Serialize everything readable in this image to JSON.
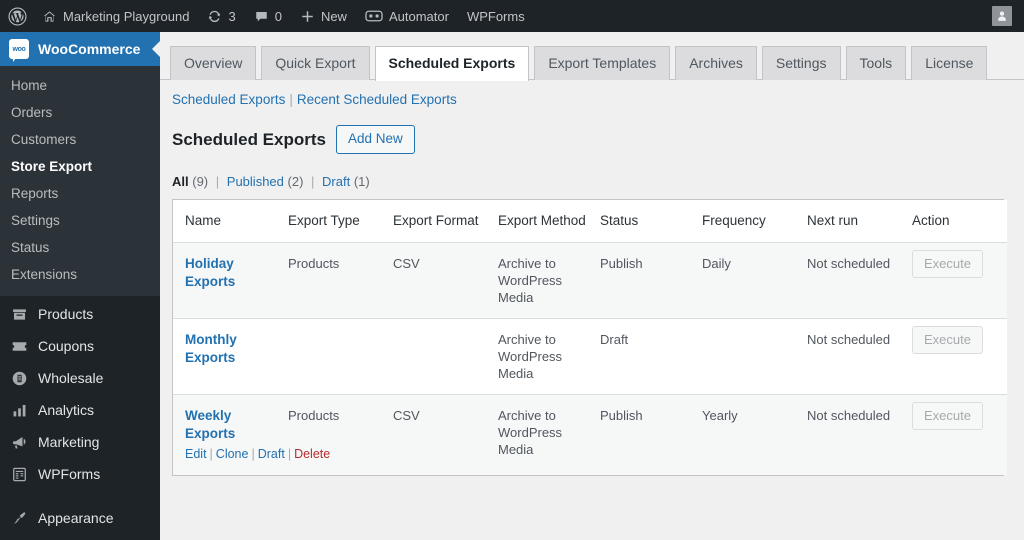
{
  "adminbar": {
    "items": [
      {
        "icon": "wordpress-logo-icon",
        "label": ""
      },
      {
        "icon": "home-icon",
        "label": "Marketing Playground"
      },
      {
        "icon": "updates-icon",
        "label": "3"
      },
      {
        "icon": "comment-bubble-icon",
        "label": "0"
      },
      {
        "icon": "plus-icon",
        "label": "New"
      },
      {
        "icon": "automator-robot-icon",
        "label": "Automator"
      },
      {
        "icon": "",
        "label": "WPForms"
      }
    ],
    "account_icon": "user-avatar-icon"
  },
  "sidebar": {
    "header": {
      "label": "WooCommerce",
      "logo": "woocommerce-logo-icon",
      "logo_text": "woo"
    },
    "submenu": [
      {
        "label": "Home",
        "current": false
      },
      {
        "label": "Orders",
        "current": false
      },
      {
        "label": "Customers",
        "current": false
      },
      {
        "label": "Store Export",
        "current": true
      },
      {
        "label": "Reports",
        "current": false
      },
      {
        "label": "Settings",
        "current": false
      },
      {
        "label": "Status",
        "current": false
      },
      {
        "label": "Extensions",
        "current": false
      }
    ],
    "menu": [
      {
        "label": "Products",
        "icon": "products-box-icon"
      },
      {
        "label": "Coupons",
        "icon": "coupon-ticket-icon"
      },
      {
        "label": "Wholesale",
        "icon": "wholesale-icon"
      },
      {
        "label": "Analytics",
        "icon": "bar-chart-icon"
      },
      {
        "label": "Marketing",
        "icon": "megaphone-icon"
      },
      {
        "label": "WPForms",
        "icon": "wpforms-icon"
      }
    ],
    "menu_secondary": [
      {
        "label": "Appearance",
        "icon": "paintbrush-icon"
      }
    ]
  },
  "tabs": [
    {
      "label": "Overview",
      "active": false
    },
    {
      "label": "Quick Export",
      "active": false
    },
    {
      "label": "Scheduled Exports",
      "active": true
    },
    {
      "label": "Export Templates",
      "active": false
    },
    {
      "label": "Archives",
      "active": false
    },
    {
      "label": "Settings",
      "active": false
    },
    {
      "label": "Tools",
      "active": false
    },
    {
      "label": "License",
      "active": false
    }
  ],
  "subnav": {
    "link1": "Scheduled Exports",
    "separator": "|",
    "link2": "Recent Scheduled Exports"
  },
  "page": {
    "title": "Scheduled Exports",
    "add_new_label": "Add New"
  },
  "filters": {
    "all_label": "All",
    "all_count": "(9)",
    "published_label": "Published",
    "published_count": "(2)",
    "draft_label": "Draft",
    "draft_count": "(1)",
    "separator": "|"
  },
  "table": {
    "columns": [
      "Name",
      "Export Type",
      "Export Format",
      "Export Method",
      "Status",
      "Frequency",
      "Next run",
      "Action"
    ],
    "rows": [
      {
        "name": "Holiday Exports",
        "export_type": "Products",
        "export_format": "CSV",
        "export_method": "Archive to WordPress Media",
        "status": "Publish",
        "frequency": "Daily",
        "next_run": "Not scheduled",
        "action_label": "Execute",
        "actions": []
      },
      {
        "name": "Monthly Exports",
        "export_type": "",
        "export_format": "",
        "export_method": "Archive to WordPress Media",
        "status": "Draft",
        "frequency": "",
        "next_run": "Not scheduled",
        "action_label": "Execute",
        "actions": []
      },
      {
        "name": "Weekly Exports",
        "export_type": "Products",
        "export_format": "CSV",
        "export_method": "Archive to WordPress Media",
        "status": "Publish",
        "frequency": "Yearly",
        "next_run": "Not scheduled",
        "action_label": "Execute",
        "actions": [
          {
            "label": "Edit",
            "kind": "normal"
          },
          {
            "label": "Clone",
            "kind": "normal"
          },
          {
            "label": "Draft",
            "kind": "normal"
          },
          {
            "label": "Delete",
            "kind": "danger"
          }
        ]
      }
    ]
  },
  "colors": {
    "admin_bg": "#1d2327",
    "submenu_bg": "#2c3338",
    "accent_blue": "#2271b1",
    "page_bg": "#f0f0f1",
    "danger_red": "#b32d2e",
    "row_stripe": "#f6f7f7"
  }
}
